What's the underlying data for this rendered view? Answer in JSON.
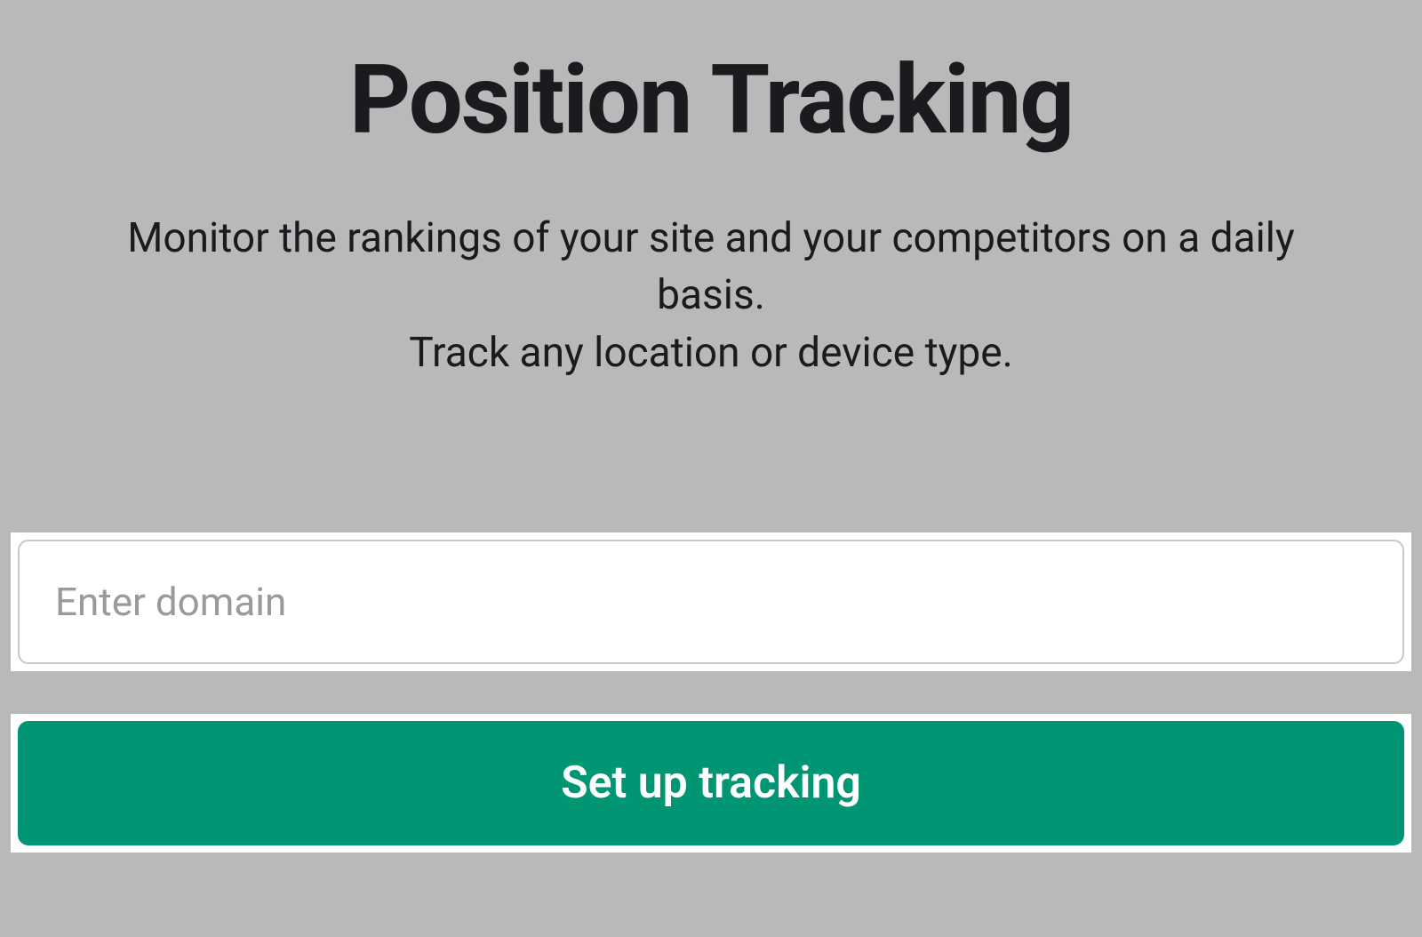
{
  "header": {
    "title": "Position Tracking",
    "subtitle_line1": "Monitor the rankings of your site and your competitors on a daily basis.",
    "subtitle_line2": "Track any location or device type."
  },
  "form": {
    "domain_placeholder": "Enter domain",
    "domain_value": "",
    "submit_label": "Set up tracking"
  },
  "colors": {
    "background": "#b9b9b9",
    "text_primary": "#1a1a1f",
    "placeholder": "#9a9a9a",
    "button_bg": "#009674",
    "button_text": "#ffffff",
    "input_border": "#c8c8c8",
    "wrapper_bg": "#ffffff"
  }
}
